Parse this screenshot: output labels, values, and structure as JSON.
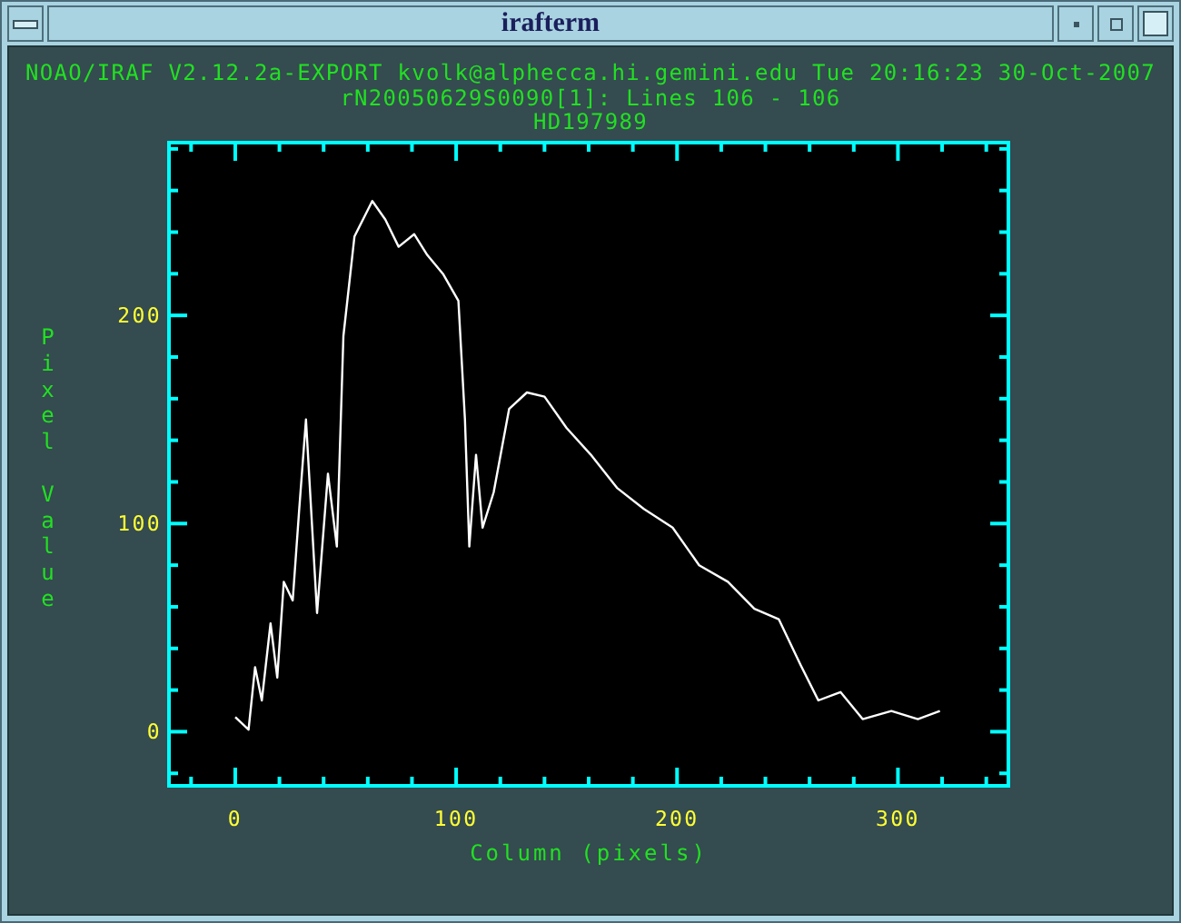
{
  "window": {
    "title": "irafterm"
  },
  "header": {
    "lines": [
      "NOAO/IRAF V2.12.2a-EXPORT kvolk@alphecca.hi.gemini.edu Tue 20:16:23 30-Oct-2007",
      "rN20050629S0090[1]: Lines 106 - 106",
      "HD197989"
    ]
  },
  "plot": {
    "chart_data": {
      "type": "line",
      "xlabel": "Column (pixels)",
      "ylabel": "Pixel Value",
      "xlim": [
        -30,
        350
      ],
      "ylim": [
        -26,
        283
      ],
      "xticks": [
        0,
        100,
        200,
        300
      ],
      "yticks": [
        0,
        100,
        200
      ],
      "x": [
        0,
        6,
        9,
        12,
        16,
        19,
        22,
        26,
        29,
        32,
        37,
        42,
        46,
        49,
        54,
        62,
        68,
        74,
        81,
        87,
        94,
        101,
        104,
        106,
        109,
        112,
        117,
        124,
        132,
        140,
        150,
        161,
        173,
        185,
        198,
        210,
        223,
        235,
        246,
        256,
        264,
        274,
        284,
        297,
        309,
        319
      ],
      "series": [
        {
          "color": "#ffffff",
          "values": [
            7,
            1,
            31,
            15,
            52,
            26,
            72,
            63,
            107,
            150,
            57,
            124,
            89,
            190,
            238,
            255,
            246,
            233,
            239,
            229,
            220,
            207,
            150,
            89,
            133,
            98,
            115,
            155,
            163,
            161,
            146,
            133,
            117,
            107,
            98,
            80,
            72,
            59,
            54,
            32,
            15,
            19,
            6,
            10,
            6,
            10
          ]
        }
      ]
    }
  }
}
